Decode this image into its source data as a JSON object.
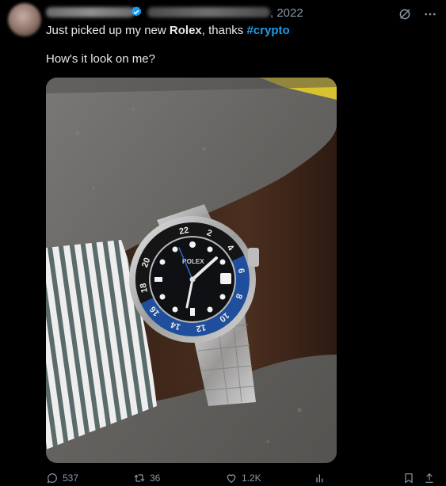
{
  "header": {
    "date": ", 2022"
  },
  "tweet": {
    "text_prefix": "Just picked up my new ",
    "text_bold": "Rolex",
    "text_middle": ", thanks ",
    "hashtag": "#crypto",
    "line2": "How's it look on me?"
  },
  "photo": {
    "bezel_numbers": [
      "22",
      "2",
      "4",
      "6",
      "8",
      "10",
      "12",
      "14",
      "16",
      "18",
      "20"
    ],
    "dial_brand": "ROLEX"
  },
  "actions": {
    "replies": "537",
    "retweets": "36",
    "likes": "1.2K"
  },
  "icons": {
    "verified": "verified-badge-icon",
    "grok": "grok-icon",
    "more": "more-icon",
    "reply": "reply-icon",
    "retweet": "retweet-icon",
    "like": "heart-icon",
    "views": "views-icon",
    "bookmark": "bookmark-icon",
    "share": "share-icon"
  },
  "colors": {
    "background": "#000000",
    "text": "#e7e9ea",
    "muted": "#8b98a5",
    "link": "#1d9bf0"
  }
}
